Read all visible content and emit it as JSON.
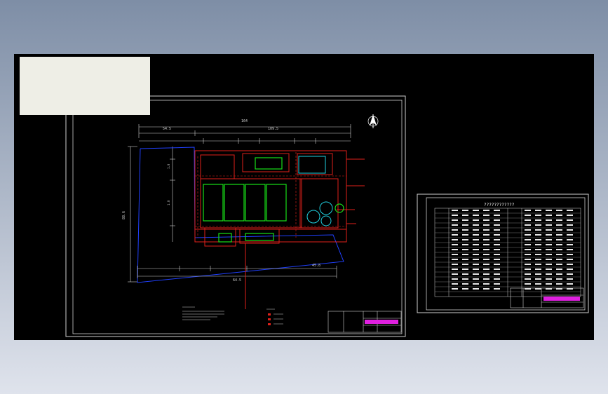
{
  "colors": {
    "bg_top": "#7e8ea6",
    "bg_bottom": "#dfe3ec",
    "canvas": "#000000",
    "frame": "#d0d0d0",
    "pipe_red": "#e0201a",
    "tank_green": "#18e018",
    "cyan": "#20d0e0",
    "magenta": "#e020e0",
    "outline_blue": "#2040ff",
    "overlay_box": "#eeeee6"
  },
  "icons": {
    "north_arrow": "north-arrow-icon"
  },
  "drawing": {
    "dim_overall_top": "164",
    "dim_top_left": "54.5",
    "dim_top_right": "109.5",
    "dim_left_vertical": "88.6",
    "dim_bottom_left": "64.5",
    "dim_bottom_right": "45.8"
  },
  "table_panel": {
    "title": "????????????"
  }
}
